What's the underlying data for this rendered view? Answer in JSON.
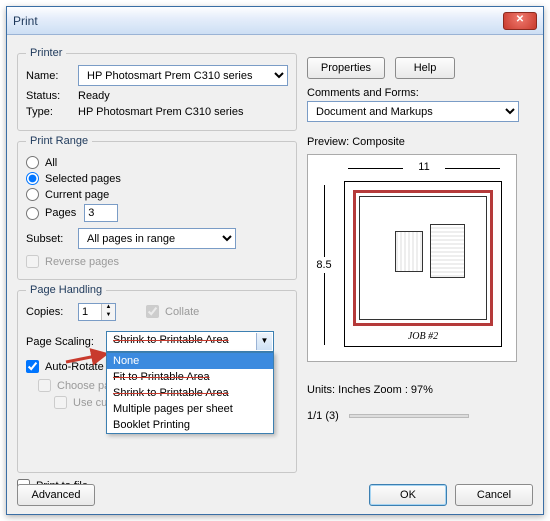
{
  "window": {
    "title": "Print"
  },
  "printer": {
    "legend": "Printer",
    "name_label": "Name:",
    "name_value": "HP Photosmart Prem C310 series",
    "status_label": "Status:",
    "status_value": "Ready",
    "type_label": "Type:",
    "type_value": "HP Photosmart Prem C310 series",
    "properties_btn": "Properties",
    "help_btn": "Help",
    "comments_label": "Comments and Forms:",
    "comments_value": "Document and Markups"
  },
  "range": {
    "legend": "Print Range",
    "all": "All",
    "selected": "Selected pages",
    "current": "Current page",
    "pages_label": "Pages",
    "pages_value": "3",
    "subset_label": "Subset:",
    "subset_value": "All pages in range",
    "reverse": "Reverse pages"
  },
  "handling": {
    "legend": "Page Handling",
    "copies_label": "Copies:",
    "copies_value": "1",
    "collate": "Collate",
    "scaling_label": "Page Scaling:",
    "scaling_selected": "Shrink to Printable Area",
    "scaling_options_strike": [
      "Fit to Printable Area",
      "Shrink to Printable Area"
    ],
    "scaling_option_sel": "None",
    "scaling_options_plain": [
      "Multiple pages per sheet",
      "Booklet Printing"
    ],
    "auto_rotate": "Auto-Rotate",
    "choose_paper": "Choose pape",
    "custom_paper": "Use custom paper size when needed"
  },
  "preview": {
    "label": "Preview: Composite",
    "dim_w": "11",
    "dim_h": "8.5",
    "job": "JOB #2",
    "units": "Units: Inches Zoom :  97%",
    "page_of": "1/1 (3)"
  },
  "print_to_file": "Print to file",
  "buttons": {
    "advanced": "Advanced",
    "ok": "OK",
    "cancel": "Cancel"
  }
}
